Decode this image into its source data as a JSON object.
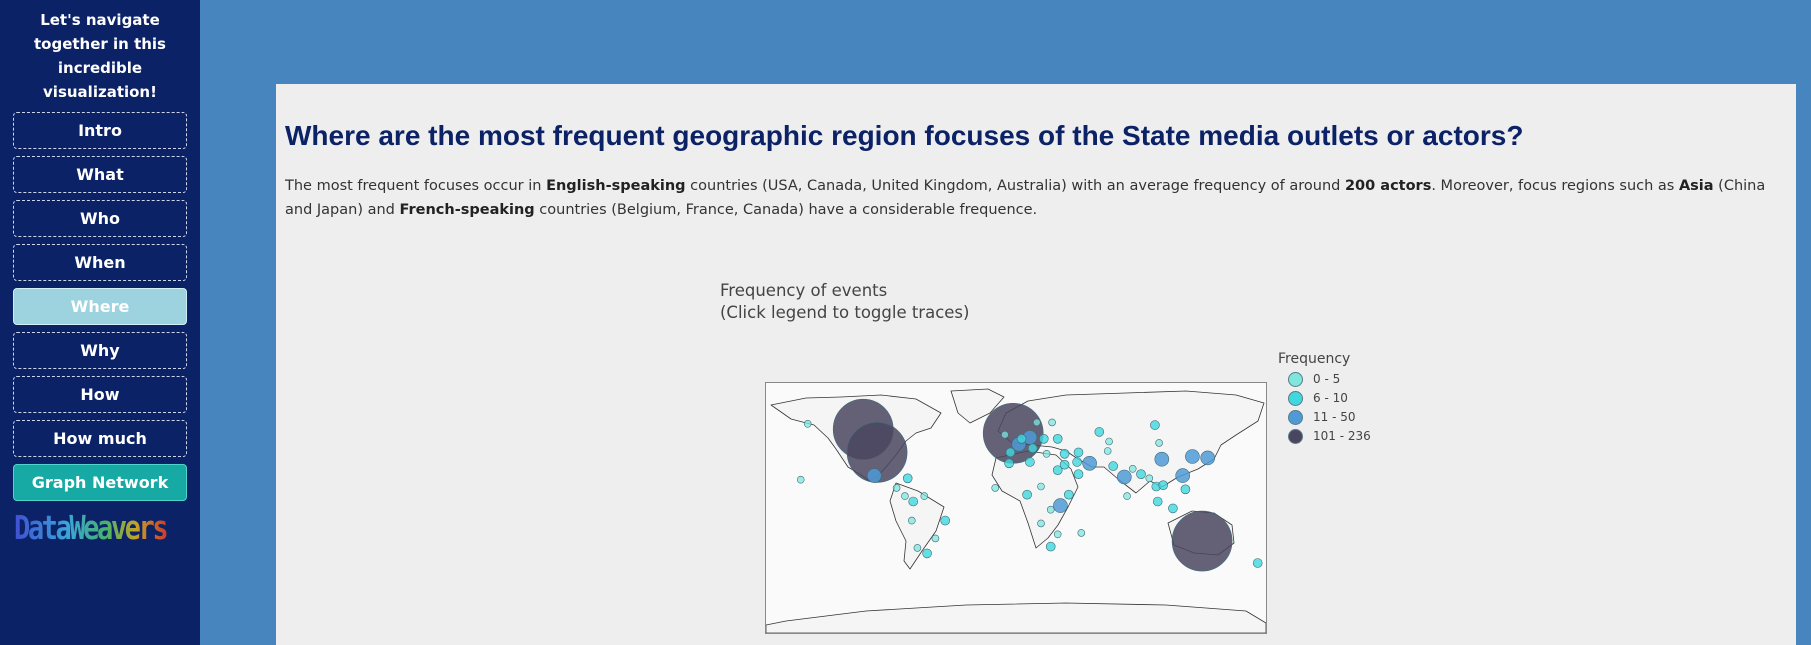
{
  "sidebar": {
    "title": "Let's navigate together in this incredible visualization!",
    "items": [
      {
        "label": "Intro"
      },
      {
        "label": "What"
      },
      {
        "label": "Who"
      },
      {
        "label": "When"
      },
      {
        "label": "Where",
        "active": true
      },
      {
        "label": "Why"
      },
      {
        "label": "How"
      },
      {
        "label": "How much"
      },
      {
        "label": "Graph Network"
      }
    ],
    "logo": "DataWeavers"
  },
  "main": {
    "title": "Where are the most frequent geographic region focuses of the State media outlets or actors?",
    "intro": {
      "t1": "The most frequent focuses occur in ",
      "b1": "English-speaking",
      "t2": " countries (USA, Canada, United Kingdom, Australia) with an average frequency of around ",
      "b2": "200 actors",
      "t3": ". Moreover, focus regions such as ",
      "b3": "Asia",
      "t4": " (China and Japan) and ",
      "b4": "French-speaking",
      "t5": " countries (Belgium, France, Canada) have a considerable frequence."
    }
  },
  "chart_data": {
    "type": "scatter",
    "title_line1": "Frequency of events",
    "title_line2": "(Click legend to toggle traces)",
    "legend_title": "Frequency",
    "legend_placement": "right",
    "series": [
      {
        "name": "0 - 5",
        "color": "#7fe6dd"
      },
      {
        "name": "6 - 10",
        "color": "#3fd8dd"
      },
      {
        "name": "11 - 50",
        "color": "#4f9ad6"
      },
      {
        "name": "101 - 236",
        "color": "#4a4660"
      }
    ],
    "points": [
      {
        "lon": -110,
        "lat": 57,
        "s": 3
      },
      {
        "lon": -100,
        "lat": 40,
        "s": 3
      },
      {
        "lon": -2,
        "lat": 54,
        "s": 3
      },
      {
        "lon": 134,
        "lat": -25,
        "s": 3
      },
      {
        "lon": 105,
        "lat": 35,
        "s": 2
      },
      {
        "lon": 138,
        "lat": 36,
        "s": 2
      },
      {
        "lon": 78,
        "lat": 22,
        "s": 2
      },
      {
        "lon": -102,
        "lat": 23,
        "s": 2
      },
      {
        "lon": 127,
        "lat": 37,
        "s": 2
      },
      {
        "lon": 32,
        "lat": 1,
        "s": 2
      },
      {
        "lon": 53,
        "lat": 32,
        "s": 2
      },
      {
        "lon": -51,
        "lat": -10,
        "s": 1
      },
      {
        "lon": 120,
        "lat": 23,
        "s": 2
      },
      {
        "lon": 122,
        "lat": 13,
        "s": 1
      },
      {
        "lon": 20,
        "lat": 50,
        "s": 1
      },
      {
        "lon": 30,
        "lat": 50,
        "s": 1
      },
      {
        "lon": 45,
        "lat": 40,
        "s": 1
      },
      {
        "lon": 35,
        "lat": 39,
        "s": 1
      },
      {
        "lon": 44,
        "lat": 33,
        "s": 1
      },
      {
        "lon": 45,
        "lat": 24,
        "s": 1
      },
      {
        "lon": 30,
        "lat": 27,
        "s": 1
      },
      {
        "lon": 10,
        "lat": 33,
        "s": 1
      },
      {
        "lon": -5,
        "lat": 32,
        "s": 1
      },
      {
        "lon": 8,
        "lat": 9,
        "s": 1
      },
      {
        "lon": 18,
        "lat": 15,
        "s": 0
      },
      {
        "lon": -15,
        "lat": 14,
        "s": 0
      },
      {
        "lon": 25,
        "lat": -2,
        "s": 0
      },
      {
        "lon": 25,
        "lat": -29,
        "s": 1
      },
      {
        "lon": 38,
        "lat": 9,
        "s": 1
      },
      {
        "lon": 18,
        "lat": -12,
        "s": 0
      },
      {
        "lon": 47,
        "lat": -19,
        "s": 0
      },
      {
        "lon": 30,
        "lat": -20,
        "s": 0
      },
      {
        "lon": 70,
        "lat": 30,
        "s": 1
      },
      {
        "lon": 66,
        "lat": 41,
        "s": 0
      },
      {
        "lon": 90,
        "lat": 24,
        "s": 1
      },
      {
        "lon": 101,
        "lat": 15,
        "s": 1
      },
      {
        "lon": 106,
        "lat": 16,
        "s": 1
      },
      {
        "lon": 113,
        "lat": -1,
        "s": 1
      },
      {
        "lon": 102,
        "lat": 4,
        "s": 1
      },
      {
        "lon": 96,
        "lat": 21,
        "s": 0
      },
      {
        "lon": 103,
        "lat": 47,
        "s": 0
      },
      {
        "lon": 174,
        "lat": -41,
        "s": 1
      },
      {
        "lon": -74,
        "lat": 4,
        "s": 1
      },
      {
        "lon": -66,
        "lat": 8,
        "s": 0
      },
      {
        "lon": -75,
        "lat": -10,
        "s": 0
      },
      {
        "lon": -64,
        "lat": -34,
        "s": 1
      },
      {
        "lon": -71,
        "lat": -30,
        "s": 0
      },
      {
        "lon": -78,
        "lat": 21,
        "s": 1
      },
      {
        "lon": -86,
        "lat": 14,
        "s": 0
      },
      {
        "lon": -58,
        "lat": -23,
        "s": 0
      },
      {
        "lon": -80,
        "lat": 8,
        "s": 0
      },
      {
        "lon": 10,
        "lat": 51,
        "s": 2
      },
      {
        "lon": 2,
        "lat": 46,
        "s": 2
      },
      {
        "lon": 12,
        "lat": 43,
        "s": 1
      },
      {
        "lon": -4,
        "lat": 40,
        "s": 1
      },
      {
        "lon": 15,
        "lat": 62,
        "s": 0
      },
      {
        "lon": 26,
        "lat": 62,
        "s": 0
      },
      {
        "lon": 4,
        "lat": 50,
        "s": 1
      },
      {
        "lon": 22,
        "lat": 39,
        "s": 0
      },
      {
        "lon": 100,
        "lat": 60,
        "s": 1
      },
      {
        "lon": 60,
        "lat": 55,
        "s": 1
      },
      {
        "lon": -8,
        "lat": 53,
        "s": 0
      },
      {
        "lon": 35,
        "lat": 31,
        "s": 1
      },
      {
        "lon": 67,
        "lat": 48,
        "s": 0
      },
      {
        "lon": 84,
        "lat": 28,
        "s": 0
      },
      {
        "lon": 80,
        "lat": 8,
        "s": 0
      },
      {
        "lon": -155,
        "lat": 20,
        "s": 0
      },
      {
        "lon": -150,
        "lat": 61,
        "s": 0
      }
    ]
  }
}
